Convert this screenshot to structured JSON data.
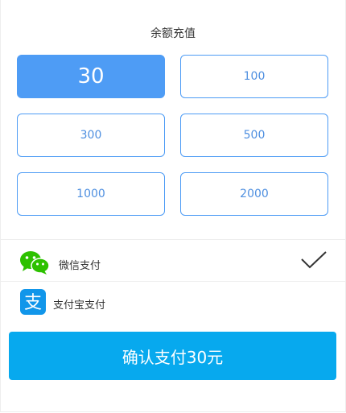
{
  "title": "余额充值",
  "amounts": [
    {
      "label": "30",
      "selected": true
    },
    {
      "label": "100",
      "selected": false
    },
    {
      "label": "300",
      "selected": false
    },
    {
      "label": "500",
      "selected": false
    },
    {
      "label": "1000",
      "selected": false
    },
    {
      "label": "2000",
      "selected": false
    }
  ],
  "payment_methods": [
    {
      "label": "微信支付",
      "icon": "wechat-icon",
      "selected": true
    },
    {
      "label": "支付宝支付",
      "icon": "alipay-icon",
      "selected": false
    }
  ],
  "confirm_label": "确认支付30元",
  "colors": {
    "accent": "#4e9cf5",
    "confirm": "#07a9ee",
    "wechat": "#2dc100",
    "alipay": "#1196ea"
  }
}
